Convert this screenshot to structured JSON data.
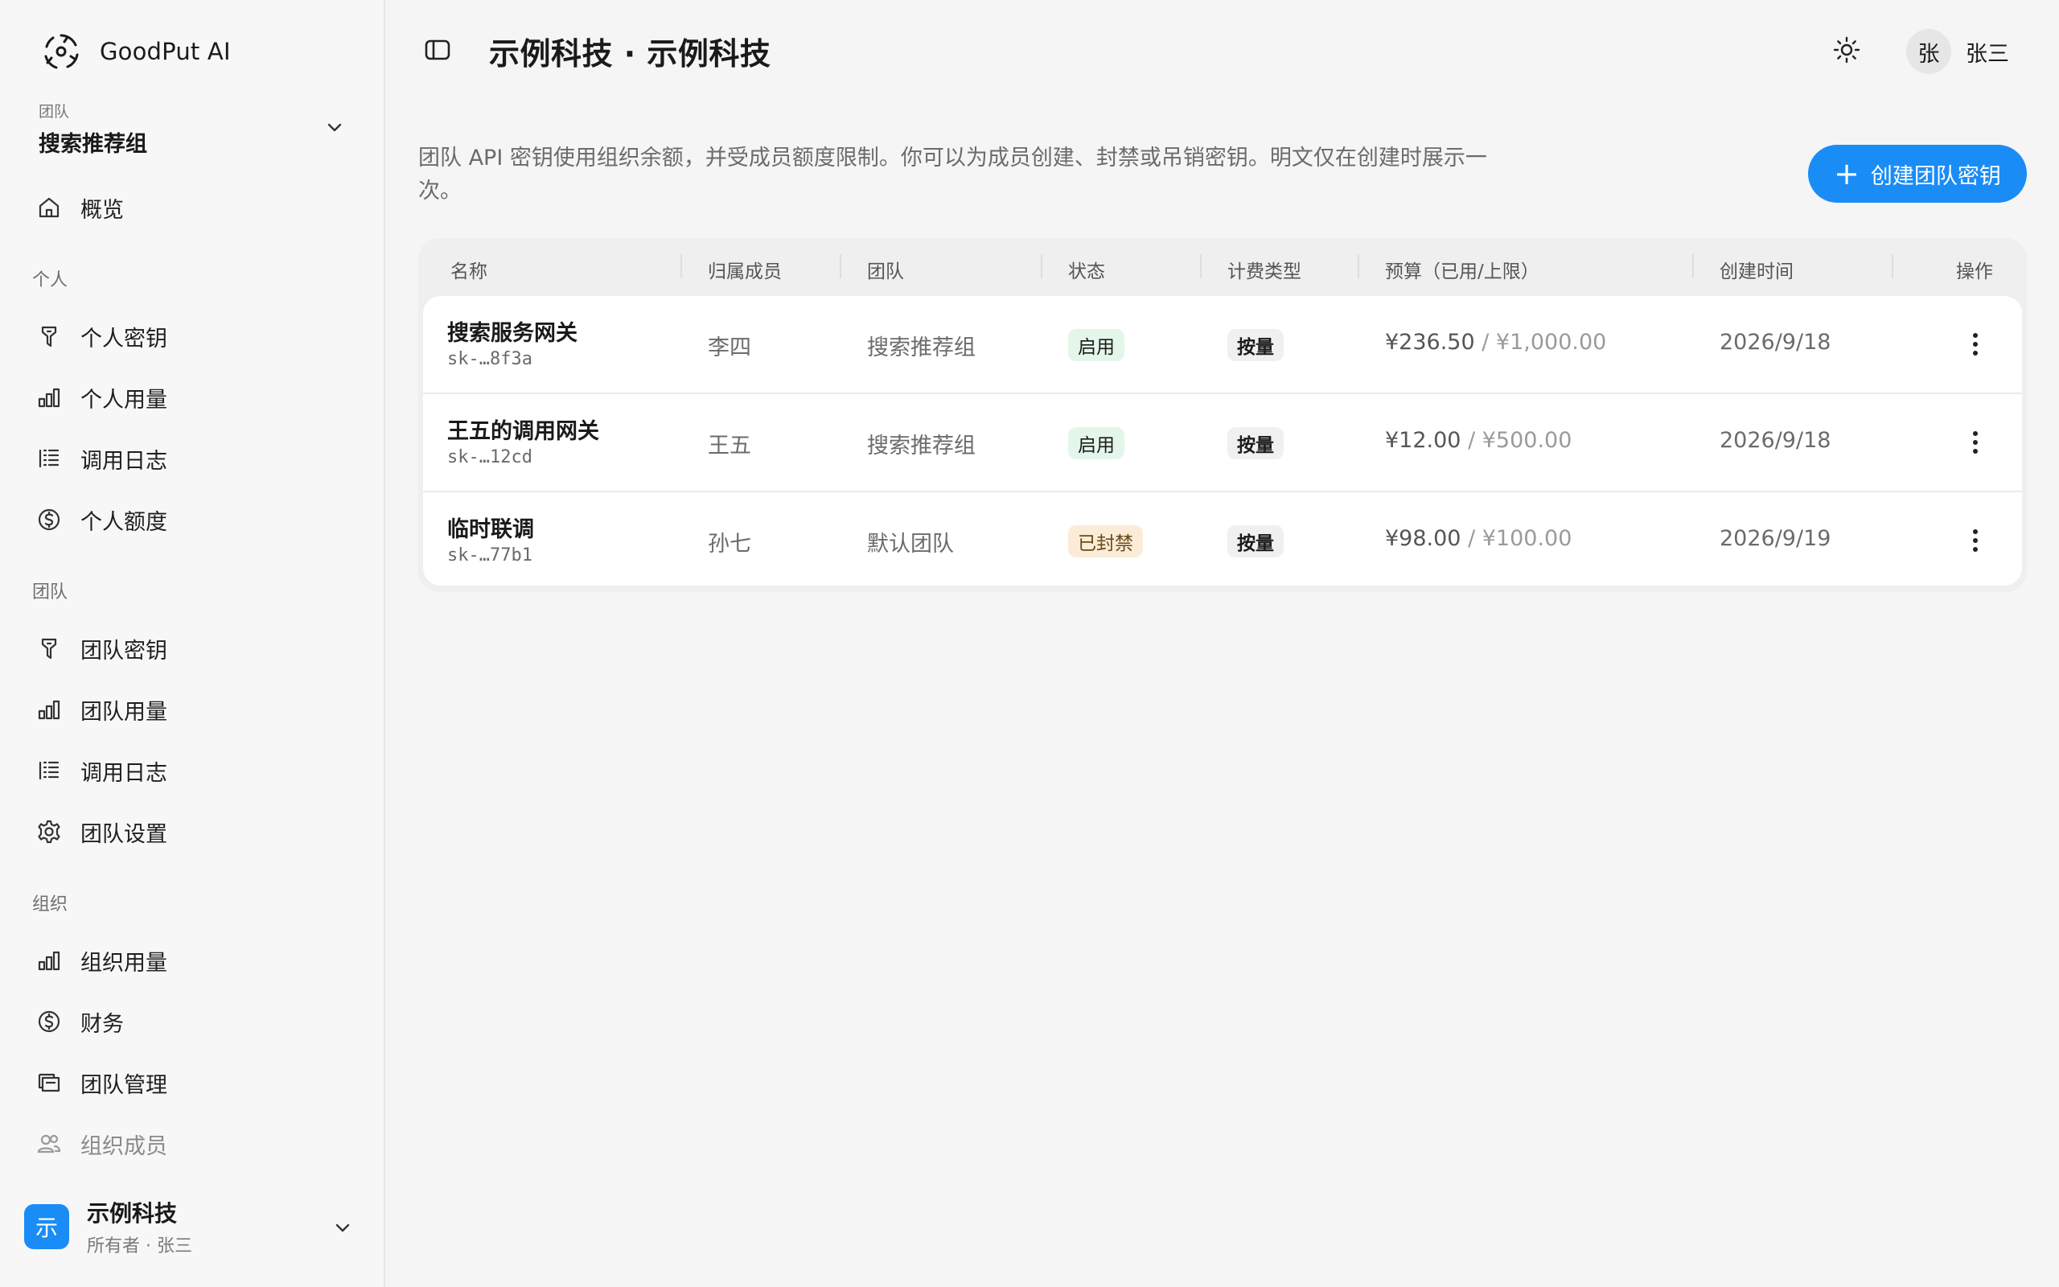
{
  "app": {
    "brand_name": "GoodPut AI"
  },
  "team_switcher": {
    "label": "团队",
    "name": "搜索推荐组"
  },
  "nav": {
    "overview": "概览",
    "section_personal": "个人",
    "personal_keys": "个人密钥",
    "personal_usage": "个人用量",
    "personal_logs": "调用日志",
    "personal_quota": "个人额度",
    "section_team": "团队",
    "team_keys": "团队密钥",
    "team_usage": "团队用量",
    "team_logs": "调用日志",
    "team_settings": "团队设置",
    "section_org": "组织",
    "org_usage": "组织用量",
    "finance": "财务",
    "team_management": "团队管理",
    "org_members": "组织成员"
  },
  "org_switcher": {
    "avatar": "示",
    "name": "示例科技",
    "role": "所有者 · 张三"
  },
  "header": {
    "title": "示例科技 · 示例科技",
    "user_avatar": "张",
    "user_name": "张三"
  },
  "description": "团队 API 密钥使用组织余额，并受成员额度限制。你可以为成员创建、封禁或吊销密钥。明文仅在创建时展示一次。",
  "create_button": "创建团队密钥",
  "table": {
    "columns": [
      "名称",
      "归属成员",
      "团队",
      "状态",
      "计费类型",
      "预算（已用/上限）",
      "创建时间",
      "操作"
    ],
    "rows": [
      {
        "name": "搜索服务网关",
        "key": "sk-…8f3a",
        "member": "李四",
        "team": "搜索推荐组",
        "status": "启用",
        "billing": "按量",
        "used": "¥236.50",
        "sep": " / ",
        "limit": "¥1,000.00",
        "created": "2026/9/18"
      },
      {
        "name": "王五的调用网关",
        "key": "sk-…12cd",
        "member": "王五",
        "team": "搜索推荐组",
        "status": "启用",
        "billing": "按量",
        "used": "¥12.00",
        "sep": " / ",
        "limit": "¥500.00",
        "created": "2026/9/18"
      },
      {
        "name": "临时联调",
        "key": "sk-…77b1",
        "member": "孙七",
        "team": "默认团队",
        "status": "已封禁",
        "billing": "按量",
        "used": "¥98.00",
        "sep": " / ",
        "limit": "¥100.00",
        "created": "2026/9/19"
      }
    ]
  },
  "colors": {
    "accent": "#1a8cf5",
    "enabled_badge": "#e4f6ea",
    "banned_badge": "#fbecd8"
  }
}
